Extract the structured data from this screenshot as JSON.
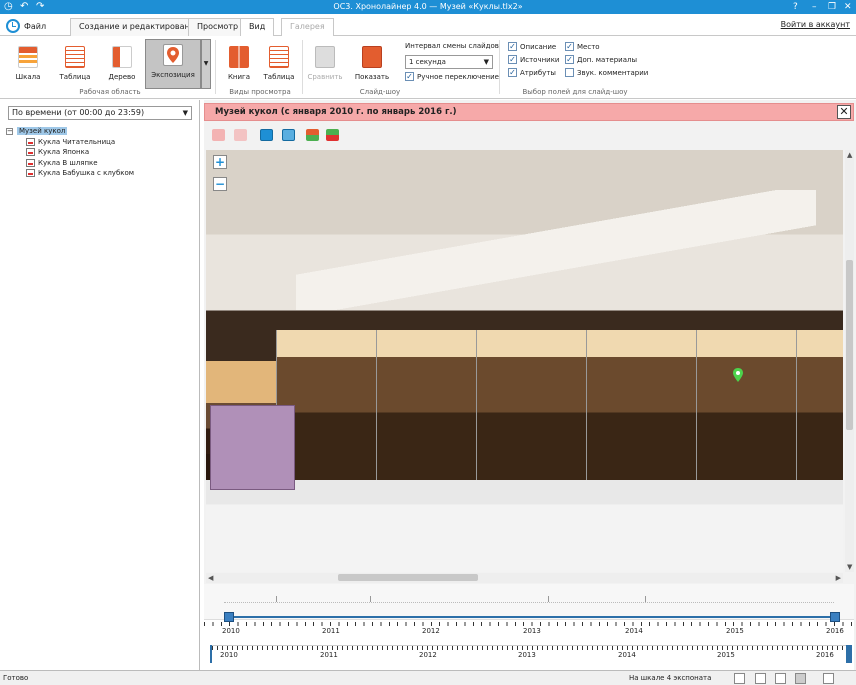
{
  "titlebar": {
    "title": "ОС3. Хронолайнер 4.0 — Музей «Куклы.tlx2»",
    "help": "?",
    "min": "–",
    "restore": "❐",
    "close": "✕"
  },
  "tabs": {
    "file": "Файл",
    "create": "Создание и редактирование",
    "preview": "Просмотр",
    "view": "Вид",
    "gallery": "Галерея",
    "login": "Войти в аккаунт"
  },
  "ribbon": {
    "scale": "Шкала",
    "table": "Таблица",
    "tree": "Дерево",
    "exposition": "Экспозиция",
    "workspace": "Рабочая область",
    "book": "Книга",
    "table2": "Таблица",
    "views": "Виды просмотра",
    "compare": "Сравнить",
    "show": "Показать",
    "slideshow": "Слайд-шоу",
    "interval_label": "Интервал смены слайдов",
    "interval_value": "1 секунда",
    "manual": "Ручное переключение",
    "fields_group": "Выбор полей для слайд-шоу",
    "f_desc": "Описание",
    "f_place": "Место",
    "f_sources": "Источники",
    "f_extra": "Доп. материалы",
    "f_attrs": "Атрибуты",
    "f_audio": "Звук. комментарии"
  },
  "left": {
    "filter": "По времени (от 00:00 до 23:59)",
    "root": "Музей кукол",
    "items": [
      "Кукла Читательница",
      "Кукла Японка",
      "Кукла В шляпке",
      "Кукла Бабушка с клубком"
    ]
  },
  "main": {
    "header": "Музей кукол (с января 2010 г. по январь 2016 г.)",
    "close": "✕",
    "zoom_in": "+",
    "zoom_out": "−"
  },
  "timeline": {
    "years": [
      "2010",
      "2011",
      "2012",
      "2013",
      "2014",
      "2015",
      "2016"
    ]
  },
  "status": {
    "ready": "Готово",
    "count": "На шкале 4 экспоната"
  }
}
